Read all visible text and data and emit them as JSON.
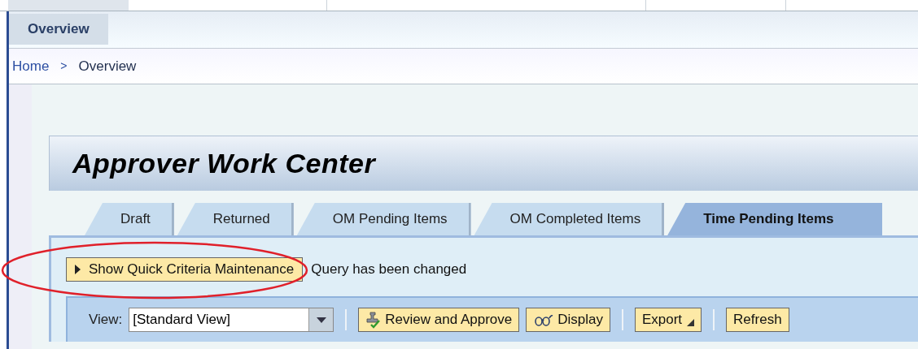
{
  "top_tabs": [
    {
      "label": "Overview",
      "selected": true
    }
  ],
  "breadcrumb": [
    {
      "label": "Home",
      "kind": "link"
    },
    {
      "label": ">",
      "kind": "separator"
    },
    {
      "label": "Overview",
      "kind": "current"
    }
  ],
  "page_title": "Approver Work Center",
  "tabs": [
    {
      "label": "Draft",
      "selected": false
    },
    {
      "label": "Returned",
      "selected": false
    },
    {
      "label": "OM Pending Items",
      "selected": false
    },
    {
      "label": "OM Completed Items",
      "selected": false
    },
    {
      "label": "Time Pending Items",
      "selected": true
    }
  ],
  "criteria_button": {
    "label": "Show Quick Criteria Maintenance",
    "highlighted": true
  },
  "status_message": "Query has been changed",
  "toolbar": {
    "view_label": "View:",
    "view_value": "[Standard View]",
    "buttons": [
      {
        "label": "Review and Approve",
        "kind": "approve"
      },
      {
        "label": "Display",
        "kind": "display"
      },
      {
        "label": "Export",
        "kind": "menu"
      },
      {
        "label": "Refresh",
        "kind": "plain"
      }
    ]
  }
}
